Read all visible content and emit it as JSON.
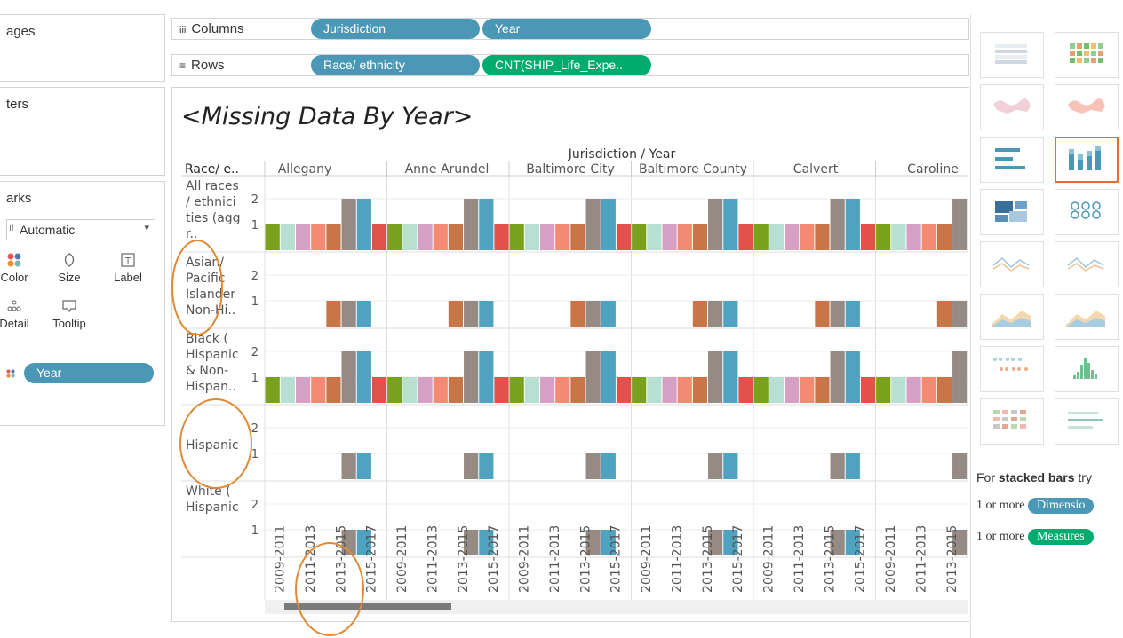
{
  "left": {
    "pages": "ages",
    "filters": "ters",
    "marks": "arks",
    "mark_type": "Automatic",
    "cards": {
      "color": "Color",
      "size": "Size",
      "label": "Label",
      "detail": "Detail",
      "tooltip": "Tooltip"
    },
    "color_pill": "Year"
  },
  "shelves": {
    "columns_label": "Columns",
    "rows_label": "Rows",
    "columns_pills": [
      "Jurisdiction",
      "Year"
    ],
    "rows_pills": [
      "Race/ ethnicity",
      "CNT(SHIP_Life_Expe.."
    ]
  },
  "view": {
    "title": "<Missing Data By Year>",
    "header_top": "Jurisdiction / Year",
    "row_header": "Race/ e..",
    "jurisdictions": [
      "Allegany",
      "Anne Arundel",
      "Baltimore City",
      "Baltimore County",
      "Calvert",
      "Caroline"
    ],
    "rows": [
      [
        "All races",
        "/ ethnici",
        "ties (agg",
        "r.."
      ],
      [
        "Asian/",
        "Pacific",
        "Islander",
        "Non-Hi.."
      ],
      [
        "Black (",
        "Hispanic",
        "& Non-",
        "Hispan.."
      ],
      [
        "Hispanic"
      ],
      [
        "White (",
        "Hispanic"
      ]
    ],
    "axis_ticks": [
      "2",
      "1"
    ],
    "year_labels": [
      "2009-2011",
      "2011-2013",
      "2013-2015",
      "2015-2017"
    ]
  },
  "colors": {
    "years": [
      "#7aa11c",
      "#b8e0d2",
      "#d6a0c4",
      "#f48a72",
      "#c87547",
      "#958a84",
      "#4fa3c0",
      "#e2514a"
    ],
    "dimension": "#4a97b6",
    "measure": "#00ab6f",
    "annotation": "#e08a36",
    "active_border": "#e66c37"
  },
  "chart_data": {
    "type": "bar",
    "title": "<Missing Data By Year>",
    "x_dimensions": [
      "Jurisdiction",
      "Year"
    ],
    "row_dimension": "Race/ ethnicity",
    "measure": "CNT(SHIP_Life_Expe..",
    "year_order": [
      "y1",
      "y2",
      "y3",
      "y4",
      "y5",
      "2013-2015",
      "y7",
      "y8"
    ],
    "patterns": {
      "full": [
        1,
        1,
        1,
        1,
        1,
        2,
        2,
        1
      ],
      "asian": [
        0,
        0,
        0,
        0,
        1,
        1,
        1,
        0
      ],
      "sparse": [
        0,
        0,
        0,
        0,
        0,
        1,
        1,
        0
      ]
    },
    "row_pattern": [
      "full",
      "asian",
      "full",
      "sparse",
      "sparse"
    ],
    "ylim": [
      0,
      2
    ]
  },
  "showme": {
    "hint_prefix": "For ",
    "hint_bold": "stacked bars",
    "hint_suffix": " try",
    "req1_prefix": "1 or more",
    "req1_pill": "Dimensio",
    "req2_prefix": "1 or more",
    "req2_pill": "Measures"
  }
}
